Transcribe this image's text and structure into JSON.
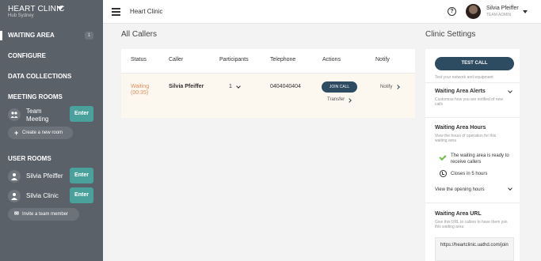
{
  "sidebar": {
    "brand": "HEART CLINIC",
    "hub": "Hub Sydney",
    "waiting_area": {
      "label": "WAITING AREA",
      "count": "1"
    },
    "configure": "CONFIGURE",
    "data_collections": "DATA COLLECTIONS",
    "meeting_rooms": {
      "title": "MEETING ROOMS",
      "rooms": [
        {
          "name": "Team Meeting",
          "enter": "Enter"
        }
      ],
      "create_label": "Create a new room"
    },
    "user_rooms": {
      "title": "USER ROOMS",
      "rooms": [
        {
          "name": "Silvia Pfeiffer",
          "enter": "Enter"
        },
        {
          "name": "Silvia Clinic",
          "enter": "Enter"
        }
      ],
      "invite_label": "Invite a team member"
    }
  },
  "header": {
    "title": "Heart Clinic",
    "user": {
      "name": "Silvia Pfeiffer",
      "role": "TEAM ADMIN"
    }
  },
  "main": {
    "title": "All Callers",
    "table": {
      "columns": [
        "Status",
        "Caller",
        "Participants",
        "Telephone",
        "Actions",
        "Notify"
      ],
      "rows": [
        {
          "status": "Waiting",
          "wait_time": "(00:35)",
          "caller": "Silvia Pfeiffer",
          "participants": "1",
          "telephone": "0404040404",
          "join_label": "JOIN CALL",
          "transfer_label": "Transfer",
          "notify_label": "Notify"
        }
      ]
    }
  },
  "settings": {
    "title": "Clinic Settings",
    "test_call": {
      "label": "TEST CALL",
      "sub": "Test your network and equipment"
    },
    "alerts": {
      "title": "Waiting Area Alerts",
      "desc": "Customise how you are notified of new calls"
    },
    "hours": {
      "title": "Waiting Area Hours",
      "desc": "View the hours of operation for this waiting area",
      "status_ready": "The waiting area is ready to receive callers",
      "closes": "Closes in 5 hours",
      "view_label": "View the opening hours"
    },
    "url": {
      "title": "Waiting Area URL",
      "desc": "Give this URL to callers to have them join this waiting area",
      "value": "https://heartclinic.uathd.com/join"
    }
  },
  "colors": {
    "sidebar": "#5a6169",
    "accent": "#4aa19c",
    "primary_button": "#2d4b61",
    "waiting_status": "#e08d5c",
    "ready_check": "#6fbf4a"
  }
}
